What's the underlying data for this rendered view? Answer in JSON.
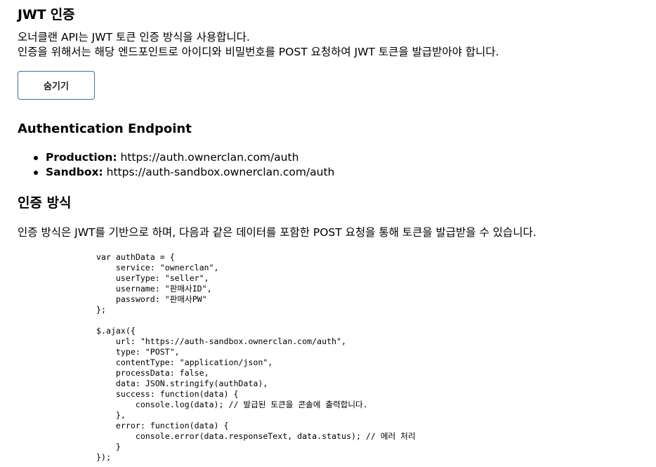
{
  "section_jwt": {
    "title": "JWT 인증",
    "intro_line1": "오너클랜 API는 JWT 토큰 인증 방식을 사용합니다.",
    "intro_line2": "인증을 위해서는 해당 엔드포인트로 아이디와 비밀번호를 POST 요청하여 JWT 토큰을 발급받아야 합니다.",
    "hide_button_label": "숨기기"
  },
  "section_endpoint": {
    "title": "Authentication Endpoint",
    "items": [
      {
        "label": "Production:",
        "url": " https://auth.ownerclan.com/auth"
      },
      {
        "label": "Sandbox:",
        "url": " https://auth-sandbox.ownerclan.com/auth"
      }
    ]
  },
  "section_method": {
    "title": "인증 방식",
    "description": "인증 방식은 JWT를 기반으로 하며, 다음과 같은 데이터를 포함한 POST 요청을 통해 토큰을 발급받을 수 있습니다.",
    "code": "var authData = {\n    service: \"ownerclan\",\n    userType: \"seller\",\n    username: \"판매사ID\",\n    password: \"판매사PW\"\n};\n\n$.ajax({\n    url: \"https://auth-sandbox.ownerclan.com/auth\",\n    type: \"POST\",\n    contentType: \"application/json\",\n    processData: false,\n    data: JSON.stringify(authData),\n    success: function(data) {\n        console.log(data); // 발급된 토큰을 콘솔에 출력합니다.\n    },\n    error: function(data) {\n        console.error(data.responseText, data.status); // 에러 처리\n    }\n});"
  }
}
